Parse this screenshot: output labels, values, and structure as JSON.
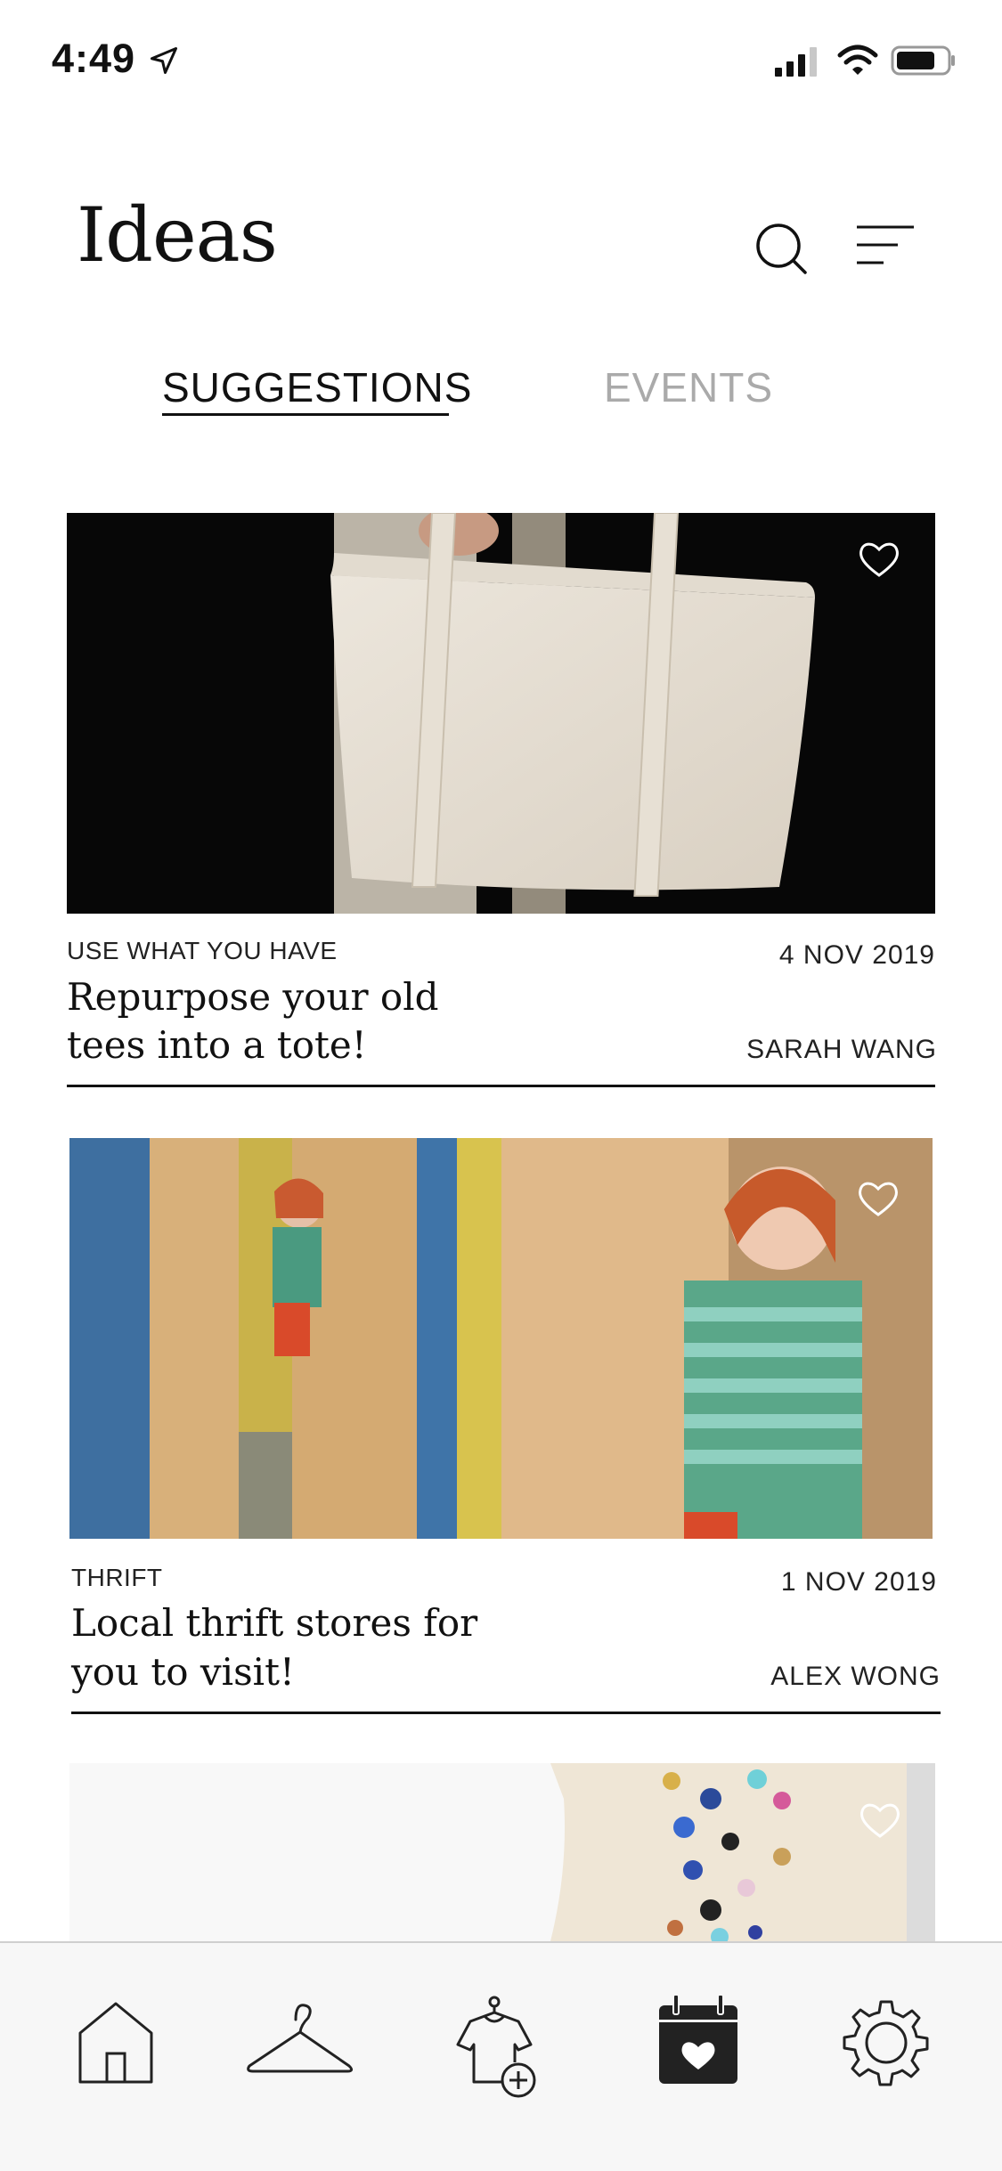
{
  "status": {
    "time": "4:49",
    "icons": [
      "location-arrow-icon",
      "signal-icon",
      "wifi-icon",
      "battery-icon"
    ]
  },
  "header": {
    "title": "Ideas",
    "icons": [
      "search-icon",
      "menu-icon"
    ]
  },
  "tabs": [
    {
      "label": "SUGGESTIONS",
      "active": true
    },
    {
      "label": "EVENTS",
      "active": false
    }
  ],
  "cards": [
    {
      "category": "USE WHAT YOU HAVE",
      "date": "4 NOV 2019",
      "title_line1": "Repurpose your old",
      "title_line2": "tees into a tote!",
      "author": "SARAH WANG"
    },
    {
      "category": "THRIFT",
      "date": "1 NOV 2019",
      "title_line1": "Local thrift stores for",
      "title_line2": "you to visit!",
      "author": "ALEX WONG"
    }
  ],
  "bottom_nav": {
    "items": [
      "home-icon",
      "hanger-icon",
      "add-clothing-icon",
      "calendar-heart-icon",
      "settings-gear-icon"
    ],
    "active_index": 3
  },
  "colors": {
    "text": "#111111",
    "inactive_tab": "#aaaaaa",
    "nav_background": "#f7f7f7"
  }
}
